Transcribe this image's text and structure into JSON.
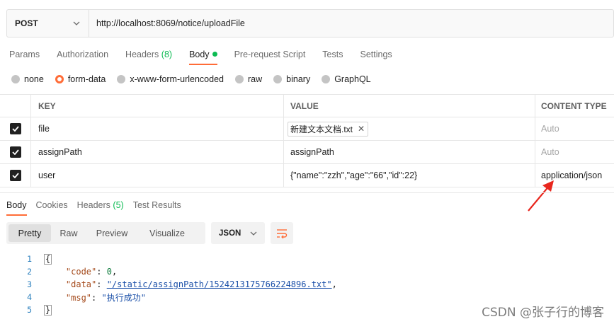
{
  "request": {
    "method": "POST",
    "url": "http://localhost:8069/notice/uploadFile"
  },
  "request_tabs": [
    {
      "label": "Params"
    },
    {
      "label": "Authorization"
    },
    {
      "label": "Headers",
      "count": "(8)"
    },
    {
      "label": "Body"
    },
    {
      "label": "Pre-request Script"
    },
    {
      "label": "Tests"
    },
    {
      "label": "Settings"
    }
  ],
  "body_types": [
    {
      "label": "none"
    },
    {
      "label": "form-data"
    },
    {
      "label": "x-www-form-urlencoded"
    },
    {
      "label": "raw"
    },
    {
      "label": "binary"
    },
    {
      "label": "GraphQL"
    }
  ],
  "params_table": {
    "headers": {
      "key": "KEY",
      "value": "VALUE",
      "content_type": "CONTENT TYPE"
    },
    "rows": [
      {
        "key": "file",
        "value": "新建文本文档.txt",
        "content_type": "Auto"
      },
      {
        "key": "assignPath",
        "value": "assignPath",
        "content_type": "Auto"
      },
      {
        "key": "user",
        "value": "{\"name\":\"zzh\",\"age\":\"66\",\"id\":22}",
        "content_type": "application/json"
      }
    ]
  },
  "response_tabs": [
    {
      "label": "Body"
    },
    {
      "label": "Cookies"
    },
    {
      "label": "Headers",
      "count": "(5)"
    },
    {
      "label": "Test Results"
    }
  ],
  "view_modes": [
    "Pretty",
    "Raw",
    "Preview",
    "Visualize"
  ],
  "format": "JSON",
  "response_code": {
    "line_numbers": [
      "1",
      "2",
      "3",
      "4",
      "5"
    ],
    "open_brace": "{",
    "close_brace": "}",
    "code_key": "\"code\"",
    "code_value": "0",
    "data_key": "\"data\"",
    "data_value": "\"/static/assignPath/1524213175766224896.txt\"",
    "msg_key": "\"msg\"",
    "msg_value": "\"执行成功\""
  },
  "watermark": "CSDN @张子行的博客",
  "colors": {
    "accent": "#ff6c37",
    "success": "#0cbb52",
    "annotation_arrow": "#e8261d"
  }
}
